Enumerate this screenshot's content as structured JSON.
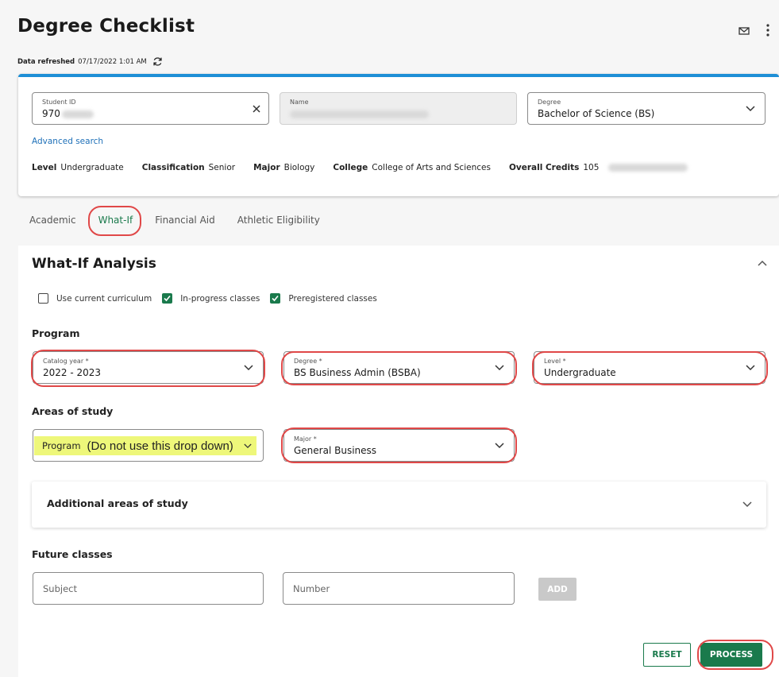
{
  "header": {
    "title": "Degree Checklist",
    "refresh_label": "Data refreshed",
    "refresh_time": "07/17/2022 1:01 AM",
    "icons": [
      "mail-icon",
      "more-vertical-icon",
      "refresh-icon"
    ]
  },
  "student": {
    "student_id_label": "Student ID",
    "student_id_value": "970",
    "name_label": "Name",
    "degree_label": "Degree",
    "degree_value": "Bachelor of Science (BS)",
    "advanced_search": "Advanced search",
    "summary": {
      "level_label": "Level",
      "level_value": "Undergraduate",
      "classification_label": "Classification",
      "classification_value": "Senior",
      "major_label": "Major",
      "major_value": "Biology",
      "college_label": "College",
      "college_value": "College of Arts and Sciences",
      "credits_label": "Overall Credits",
      "credits_value": "105"
    }
  },
  "tabs": [
    "Academic",
    "What-If",
    "Financial Aid",
    "Athletic Eligibility"
  ],
  "whatif": {
    "title": "What-If Analysis",
    "checks": [
      {
        "label": "Use current curriculum",
        "checked": false
      },
      {
        "label": "In-progress classes",
        "checked": true
      },
      {
        "label": "Preregistered classes",
        "checked": true
      }
    ],
    "program_heading": "Program",
    "catalog_label": "Catalog year *",
    "catalog_value": "2022 - 2023",
    "degree_label": "Degree *",
    "degree_value": "BS Business Admin (BSBA)",
    "level_label": "Level *",
    "level_value": "Undergraduate",
    "areas_heading": "Areas of study",
    "program_dropdown": "Program",
    "program_note": "(Do not use this drop down)",
    "major_label": "Major *",
    "major_value": "General Business",
    "additional_areas": "Additional areas of study",
    "future_heading": "Future classes",
    "subject_placeholder": "Subject",
    "number_placeholder": "Number",
    "add_label": "ADD",
    "reset_label": "RESET",
    "process_label": "PROCESS"
  },
  "colors": {
    "accent_blue": "#1e8fd6",
    "brand_green": "#1a7a4c",
    "annotation_red": "#e04848",
    "highlight_yellow": "#eef77a"
  }
}
